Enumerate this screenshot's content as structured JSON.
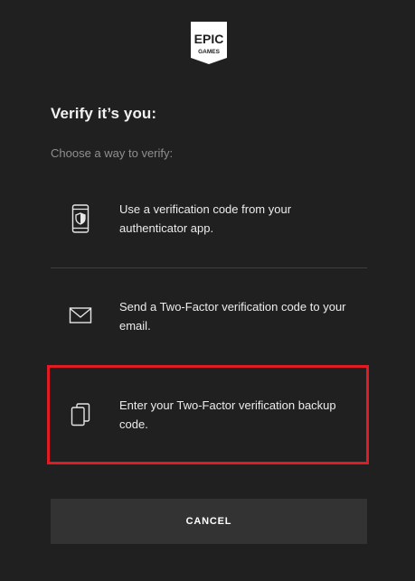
{
  "logo": {
    "top_text": "EPIC",
    "bottom_text": "GAMES"
  },
  "heading": "Verify it’s you:",
  "subheading": "Choose a way to verify:",
  "options": [
    {
      "icon": "phone-shield-icon",
      "label": "Use a verification code from your authenticator app."
    },
    {
      "icon": "envelope-icon",
      "label": "Send a Two-Factor verification code to your email."
    },
    {
      "icon": "copy-pages-icon",
      "label": "Enter your Two-Factor verification backup code."
    }
  ],
  "cancel_label": "CANCEL",
  "colors": {
    "background": "#202020",
    "button": "#333333",
    "highlight": "#e01b24",
    "muted_text": "#8f8f8f"
  }
}
